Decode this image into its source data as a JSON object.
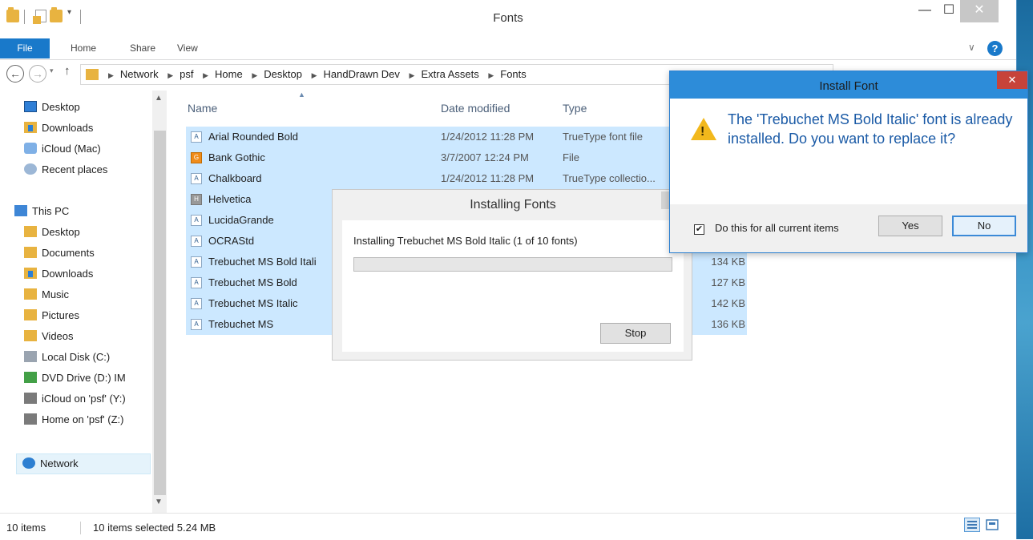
{
  "window": {
    "title": "Fonts",
    "controls": {
      "minimize": "—",
      "maximize": "☐",
      "close": "✕"
    }
  },
  "ribbon": {
    "tabs": [
      "File",
      "Home",
      "Share",
      "View"
    ],
    "help": "?",
    "expand": "∨"
  },
  "address": {
    "back": "←",
    "forward": "→",
    "up": "↑",
    "recent": "▾",
    "crumbs": [
      "Network",
      "psf",
      "Home",
      "Desktop",
      "HandDrawn Dev",
      "Extra Assets",
      "Fonts"
    ],
    "sep": "▶"
  },
  "navpane": {
    "scroll_up": "▲",
    "scroll_down": "▼",
    "items": [
      {
        "label": "Desktop"
      },
      {
        "label": "Downloads"
      },
      {
        "label": "iCloud (Mac)"
      },
      {
        "label": "Recent places"
      },
      {
        "label": "This PC"
      },
      {
        "label": "Desktop"
      },
      {
        "label": "Documents"
      },
      {
        "label": "Downloads"
      },
      {
        "label": "Music"
      },
      {
        "label": "Pictures"
      },
      {
        "label": "Videos"
      },
      {
        "label": "Local Disk (C:)"
      },
      {
        "label": "DVD Drive (D:) IM"
      },
      {
        "label": "iCloud on 'psf' (Y:)"
      },
      {
        "label": "Home on 'psf' (Z:)"
      },
      {
        "label": "Network"
      }
    ]
  },
  "filelist": {
    "columns": {
      "name": "Name",
      "date": "Date modified",
      "type": "Type"
    },
    "sort_indicator": "▲",
    "rows": [
      {
        "name": "Arial Rounded Bold",
        "date": "1/24/2012 11:28 PM",
        "type": "TrueType font file",
        "size": ""
      },
      {
        "name": "Bank Gothic",
        "date": "3/7/2007 12:24 PM",
        "type": "File",
        "size": ""
      },
      {
        "name": "Chalkboard",
        "date": "1/24/2012 11:28 PM",
        "type": "TrueType collectio...",
        "size": ""
      },
      {
        "name": "Helvetica",
        "date": "",
        "type": "",
        "size": ""
      },
      {
        "name": "LucidaGrande",
        "date": "",
        "type": "",
        "size": ""
      },
      {
        "name": "OCRAStd",
        "date": "",
        "type": "",
        "size": ""
      },
      {
        "name": "Trebuchet MS Bold Itali",
        "date": "",
        "type": "",
        "size": "134 KB"
      },
      {
        "name": "Trebuchet MS Bold",
        "date": "",
        "type": "",
        "size": "127 KB"
      },
      {
        "name": "Trebuchet MS Italic",
        "date": "",
        "type": "",
        "size": "142 KB"
      },
      {
        "name": "Trebuchet MS",
        "date": "",
        "type": "",
        "size": "136 KB"
      }
    ]
  },
  "installing_dialog": {
    "title": "Installing Fonts",
    "close": "✕",
    "message": "Installing Trebuchet MS Bold Italic (1 of 10 fonts)",
    "progress": 0,
    "stop": "Stop"
  },
  "install_font_dialog": {
    "title": "Install Font",
    "close": "✕",
    "warning": "!",
    "message": "The 'Trebuchet MS Bold Italic' font is already installed. Do you want to replace it?",
    "checkbox_label": "Do this for all current items",
    "checkbox_mark": "✔",
    "checked": true,
    "yes": "Yes",
    "no": "No"
  },
  "status": {
    "count": "10 items",
    "selection": "10 items selected  5.24 MB"
  },
  "colors": {
    "accent": "#1979ca",
    "selection": "#cce8ff",
    "dialog_title": "#2d8cd9",
    "message_text": "#1a5aa6"
  }
}
